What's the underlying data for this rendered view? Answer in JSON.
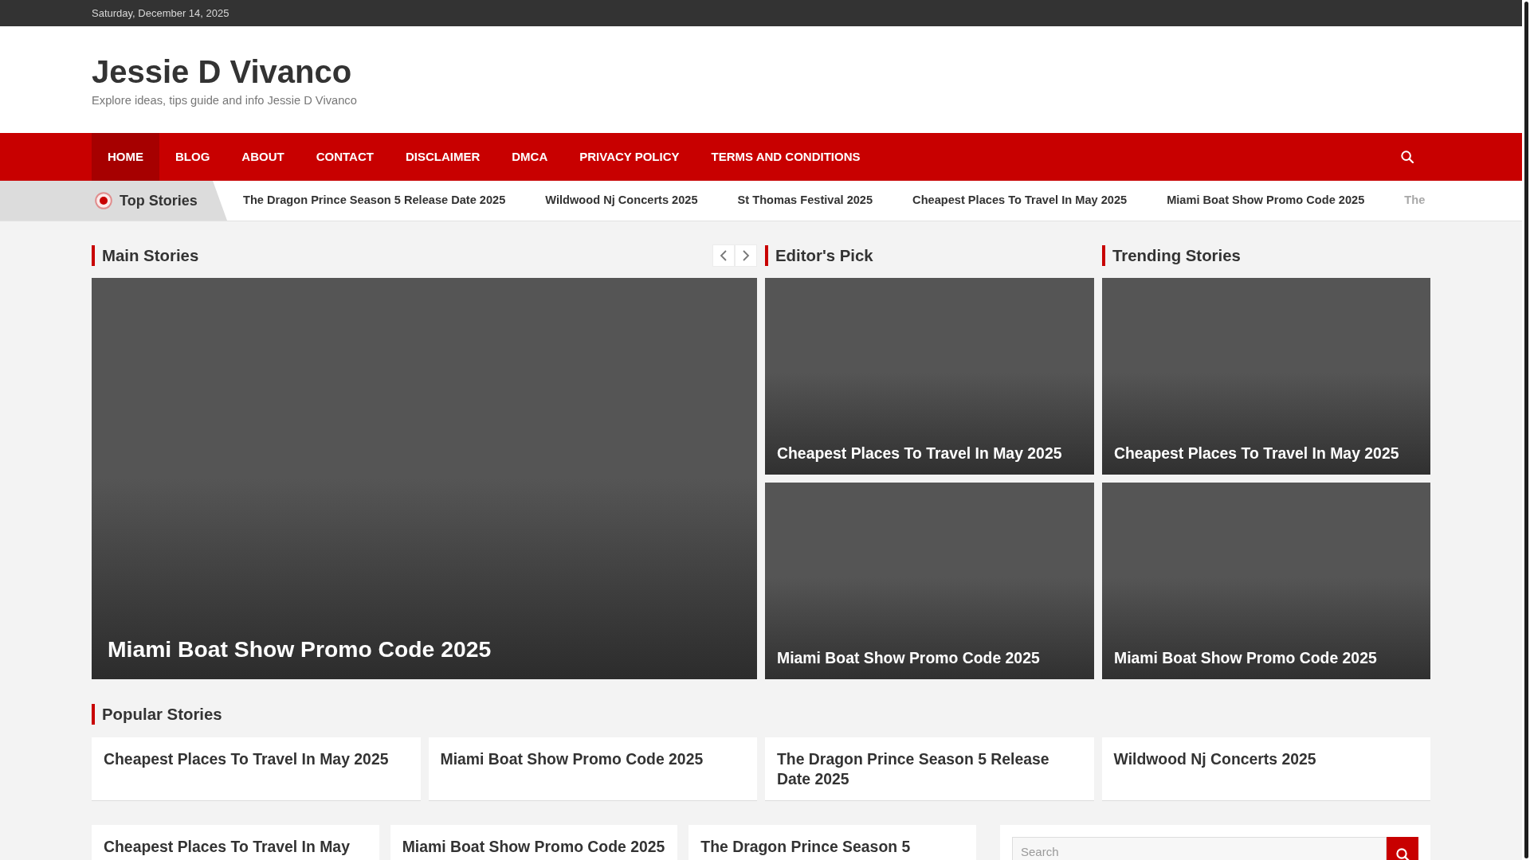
{
  "top_bar": {
    "date": "Saturday, December 14, 2025"
  },
  "site": {
    "title": "Jessie D Vivanco",
    "tagline": "Explore ideas, tips guide and info Jessie D Vivanco"
  },
  "nav": {
    "items": [
      {
        "label": "HOME",
        "selected": true
      },
      {
        "label": "BLOG",
        "selected": false
      },
      {
        "label": "ABOUT",
        "selected": false
      },
      {
        "label": "CONTACT",
        "selected": false
      },
      {
        "label": "DISCLAIMER",
        "selected": false
      },
      {
        "label": "DMCA",
        "selected": false
      },
      {
        "label": "PRIVACY POLICY",
        "selected": false
      },
      {
        "label": "TERMS AND CONDITIONS",
        "selected": false
      }
    ]
  },
  "ticker": {
    "label": "Top Stories",
    "items": [
      {
        "text": "The Dragon Prince Season 5 Release Date 2025",
        "faded": false
      },
      {
        "text": "Wildwood Nj Concerts 2025",
        "faded": false
      },
      {
        "text": "St Thomas Festival 2025",
        "faded": false
      },
      {
        "text": "Cheapest Places To Travel In May 2025",
        "faded": false
      },
      {
        "text": "Miami Boat Show Promo Code 2025",
        "faded": false
      },
      {
        "text": "The",
        "faded": true
      }
    ]
  },
  "main_stories": {
    "heading": "Main Stories",
    "slides": [
      {
        "title": "Miami Boat Show Promo Code 2025"
      }
    ]
  },
  "editors_pick": {
    "heading": "Editor's Pick",
    "stories": [
      {
        "title": "Cheapest Places To Travel In May 2025"
      },
      {
        "title": "Miami Boat Show Promo Code 2025"
      }
    ]
  },
  "trending_stories": {
    "heading": "Trending Stories",
    "stories": [
      {
        "title": "Cheapest Places To Travel In May 2025"
      },
      {
        "title": "Miami Boat Show Promo Code 2025"
      }
    ]
  },
  "popular_stories": {
    "heading": "Popular Stories",
    "stories": [
      {
        "title": "Cheapest Places To Travel In May 2025"
      },
      {
        "title": "Miami Boat Show Promo Code 2025"
      },
      {
        "title": "The Dragon Prince Season 5 Release Date 2025"
      },
      {
        "title": "Wildwood Nj Concerts 2025"
      }
    ]
  },
  "latest_posts": [
    {
      "title": "Cheapest Places To Travel In May"
    },
    {
      "title": "Miami Boat Show Promo Code 2025"
    },
    {
      "title": "The Dragon Prince Season 5"
    }
  ],
  "sidebar": {
    "search": {
      "placeholder": "Search"
    }
  }
}
